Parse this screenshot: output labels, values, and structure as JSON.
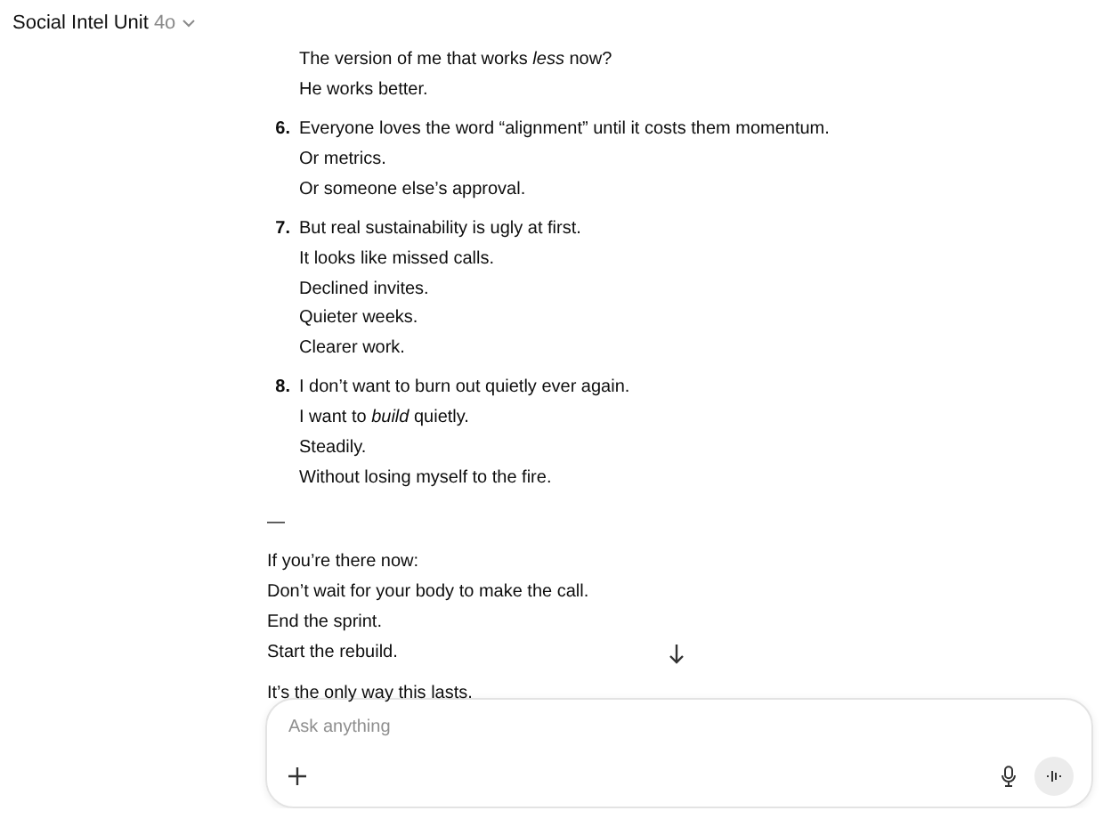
{
  "header": {
    "title": "Social Intel Unit",
    "model": "4o"
  },
  "message": {
    "lead_lines": [
      "The version of me that works *less* now?",
      "He works better."
    ],
    "items": [
      {
        "number": "6.",
        "lines": [
          "Everyone loves the word “alignment” until it costs them momentum.",
          "Or metrics.",
          "Or someone else’s approval."
        ]
      },
      {
        "number": "7.",
        "lines": [
          "But real sustainability is ugly at first.",
          "It looks like missed calls.",
          "Declined invites.",
          "Quieter weeks.",
          "Clearer work."
        ]
      },
      {
        "number": "8.",
        "lines": [
          "I don’t want to burn out quietly ever again.",
          "I want to *build* quietly.",
          "Steadily.",
          "Without losing myself to the fire."
        ]
      }
    ],
    "separator": "—",
    "closing_lines": [
      "If you’re there now:",
      "Don’t wait for your body to make the call.",
      "End the sprint.",
      "Start the rebuild."
    ],
    "final_line": "It’s the only way this lasts."
  },
  "composer": {
    "placeholder": "Ask anything"
  }
}
